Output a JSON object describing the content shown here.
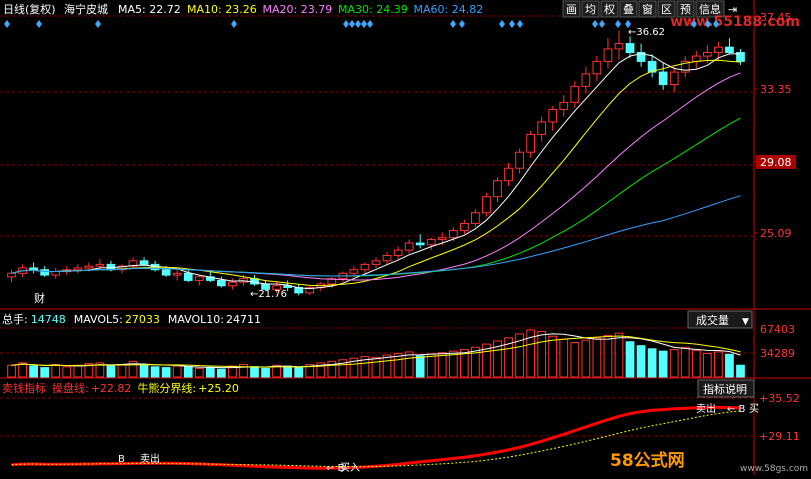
{
  "colors": {
    "bg": "#000000",
    "up": "#ff3232",
    "down": "#54ffff",
    "grid": "#800000",
    "ma5": "#ffffff",
    "ma10": "#ffff00",
    "ma20": "#ff80ff",
    "ma30": "#00e600",
    "ma60": "#33a0ff",
    "price_label": "#ff3232",
    "signal": "#ff0000",
    "bull_bear": "#ffff00",
    "diamond": "#3fa9ff"
  },
  "header": {
    "period": "日线(复权)",
    "stock_name": "海宁皮城",
    "ma": [
      {
        "key": "ma5",
        "label": "MA5:",
        "value": "22.72"
      },
      {
        "key": "ma10",
        "label": "MA10:",
        "value": "23.26"
      },
      {
        "key": "ma20",
        "label": "MA20:",
        "value": "23.79"
      },
      {
        "key": "ma30",
        "label": "MA30:",
        "value": "24.39"
      },
      {
        "key": "ma60",
        "label": "MA60:",
        "value": "24.82"
      }
    ]
  },
  "toolbar": [
    "画",
    "均",
    "权",
    "叠",
    "窗",
    "区",
    "预",
    "信息"
  ],
  "toolbar_arrow_icon": "arrow-end-icon",
  "watermark_text": "www.55188.com",
  "price_panel": {
    "ticks": [
      "37.45",
      "33.35",
      "29.08",
      "25.09"
    ],
    "high_annotation": "36.62",
    "low_annotation": "21.76",
    "cai_label": "财"
  },
  "volume_panel": {
    "label": "总手:",
    "value": "14748",
    "mavol5_label": "MAVOL5:",
    "mavol5_value": "27033",
    "mavol10_label": "MAVOL10:",
    "mavol10_value": "24711",
    "selector_label": "成交量",
    "ticks": [
      "67403",
      "34289"
    ]
  },
  "indicator_panel": {
    "name": "卖钱指标",
    "line1_label": "操盘线:",
    "line1_value": "+22.82",
    "line2_label": "牛熊分界线:",
    "line2_value": "+25.20",
    "explain_button": "指标说明",
    "ticks": [
      "+35.52",
      "+29.11"
    ],
    "signal_labels": [
      "卖出",
      "B",
      "买",
      "B",
      "卖出",
      "B",
      "买入"
    ]
  },
  "logo_text": "58公式网",
  "site_text": "www.58gs.com",
  "chart_data": {
    "type": "candlestick",
    "ohlc": [
      [
        22.8,
        23.2,
        22.5,
        23.0
      ],
      [
        23.0,
        23.5,
        22.8,
        23.3
      ],
      [
        23.3,
        23.6,
        23.0,
        23.2
      ],
      [
        23.2,
        23.4,
        22.8,
        22.9
      ],
      [
        22.9,
        23.3,
        22.7,
        23.1
      ],
      [
        23.1,
        23.4,
        22.9,
        23.2
      ],
      [
        23.2,
        23.5,
        23.0,
        23.3
      ],
      [
        23.3,
        23.6,
        23.1,
        23.4
      ],
      [
        23.4,
        23.8,
        23.2,
        23.5
      ],
      [
        23.5,
        23.7,
        23.1,
        23.2
      ],
      [
        23.2,
        23.5,
        23.0,
        23.4
      ],
      [
        23.4,
        23.9,
        23.3,
        23.7
      ],
      [
        23.7,
        23.9,
        23.4,
        23.5
      ],
      [
        23.5,
        23.7,
        23.1,
        23.2
      ],
      [
        23.2,
        23.4,
        22.8,
        22.9
      ],
      [
        22.9,
        23.2,
        22.6,
        23.0
      ],
      [
        23.0,
        23.2,
        22.5,
        22.6
      ],
      [
        22.6,
        22.9,
        22.3,
        22.8
      ],
      [
        22.8,
        23.1,
        22.5,
        22.6
      ],
      [
        22.6,
        22.8,
        22.2,
        22.3
      ],
      [
        22.3,
        22.7,
        22.1,
        22.5
      ],
      [
        22.5,
        22.9,
        22.3,
        22.7
      ],
      [
        22.7,
        22.9,
        22.3,
        22.4
      ],
      [
        22.4,
        22.6,
        22.0,
        22.1
      ],
      [
        22.1,
        22.5,
        21.9,
        22.3
      ],
      [
        22.3,
        22.6,
        22.0,
        22.2
      ],
      [
        22.2,
        22.4,
        21.76,
        21.9
      ],
      [
        21.9,
        22.3,
        21.8,
        22.2
      ],
      [
        22.2,
        22.5,
        22.0,
        22.4
      ],
      [
        22.4,
        22.8,
        22.2,
        22.7
      ],
      [
        22.7,
        23.1,
        22.5,
        23.0
      ],
      [
        23.0,
        23.4,
        22.8,
        23.2
      ],
      [
        23.2,
        23.6,
        23.0,
        23.5
      ],
      [
        23.5,
        23.9,
        23.3,
        23.7
      ],
      [
        23.7,
        24.2,
        23.5,
        24.0
      ],
      [
        24.0,
        24.5,
        23.8,
        24.3
      ],
      [
        24.3,
        24.9,
        24.1,
        24.7
      ],
      [
        24.7,
        25.2,
        24.4,
        24.6
      ],
      [
        24.6,
        25.0,
        24.3,
        24.9
      ],
      [
        24.9,
        25.3,
        24.6,
        25.0
      ],
      [
        25.0,
        25.6,
        24.8,
        25.4
      ],
      [
        25.4,
        26.0,
        25.2,
        25.8
      ],
      [
        25.8,
        26.6,
        25.6,
        26.4
      ],
      [
        26.4,
        27.5,
        26.2,
        27.3
      ],
      [
        27.3,
        28.4,
        27.0,
        28.2
      ],
      [
        28.2,
        29.2,
        27.9,
        28.9
      ],
      [
        28.9,
        30.0,
        28.6,
        29.8
      ],
      [
        29.8,
        31.0,
        29.5,
        30.8
      ],
      [
        30.8,
        31.8,
        30.4,
        31.5
      ],
      [
        31.5,
        32.4,
        31.0,
        32.2
      ],
      [
        32.2,
        33.0,
        31.8,
        32.6
      ],
      [
        32.6,
        33.8,
        32.3,
        33.5
      ],
      [
        33.5,
        34.6,
        33.1,
        34.2
      ],
      [
        34.2,
        35.2,
        33.8,
        34.9
      ],
      [
        34.9,
        36.2,
        34.5,
        35.6
      ],
      [
        35.6,
        36.62,
        35.0,
        35.9
      ],
      [
        35.9,
        36.3,
        35.1,
        35.4
      ],
      [
        35.4,
        35.9,
        34.6,
        34.9
      ],
      [
        34.9,
        35.3,
        34.0,
        34.3
      ],
      [
        34.3,
        34.8,
        33.3,
        33.6
      ],
      [
        33.6,
        34.6,
        33.2,
        34.3
      ],
      [
        34.3,
        35.2,
        34.0,
        34.9
      ],
      [
        34.9,
        35.5,
        34.5,
        35.2
      ],
      [
        35.2,
        35.8,
        34.8,
        35.4
      ],
      [
        35.4,
        36.0,
        35.0,
        35.7
      ],
      [
        35.7,
        36.2,
        35.3,
        35.4
      ],
      [
        35.4,
        35.6,
        34.7,
        34.9
      ]
    ],
    "volume": [
      15,
      18,
      14,
      12,
      16,
      13,
      15,
      17,
      18,
      14,
      16,
      20,
      15,
      13,
      12,
      14,
      13,
      11,
      12,
      10,
      14,
      16,
      13,
      11,
      15,
      14,
      12,
      16,
      18,
      20,
      22,
      24,
      26,
      25,
      28,
      30,
      32,
      27,
      29,
      31,
      33,
      35,
      38,
      42,
      46,
      50,
      55,
      60,
      58,
      52,
      48,
      44,
      47,
      50,
      53,
      56,
      45,
      40,
      36,
      33,
      35,
      38,
      34,
      30,
      32,
      29,
      15
    ],
    "ylim": [
      21.5,
      37.45
    ],
    "vol_ylim": [
      0,
      70000
    ]
  }
}
